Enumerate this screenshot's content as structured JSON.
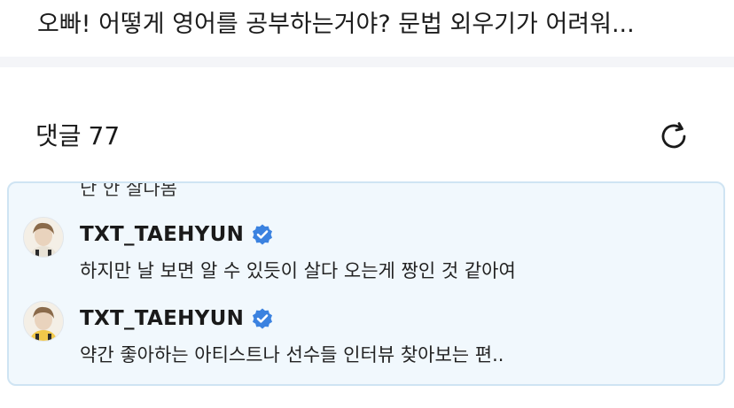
{
  "post": {
    "title": "오빠! 어떻게 영어를 공부하는거야? 문법 외우기가 어려워..."
  },
  "comments": {
    "label": "댓글",
    "count": "77",
    "refresh_icon": "refresh-icon"
  },
  "thread": {
    "clipped_text": "난 안 살다봄",
    "replies": [
      {
        "author": "TXT_TAEHYUN",
        "verified": true,
        "text": "하지만 날 보면 알 수 있듯이 살다 오는게 짱인 것 같아여"
      },
      {
        "author": "TXT_TAEHYUN",
        "verified": true,
        "text": "약간 좋아하는 아티스트나 선수들 인터뷰 찾아보는 편.."
      }
    ]
  },
  "colors": {
    "highlight_bg": "#f1f8fd",
    "highlight_border": "#cfe4f3",
    "verified_blue": "#3b82e0",
    "separator": "#f4f5f8"
  }
}
